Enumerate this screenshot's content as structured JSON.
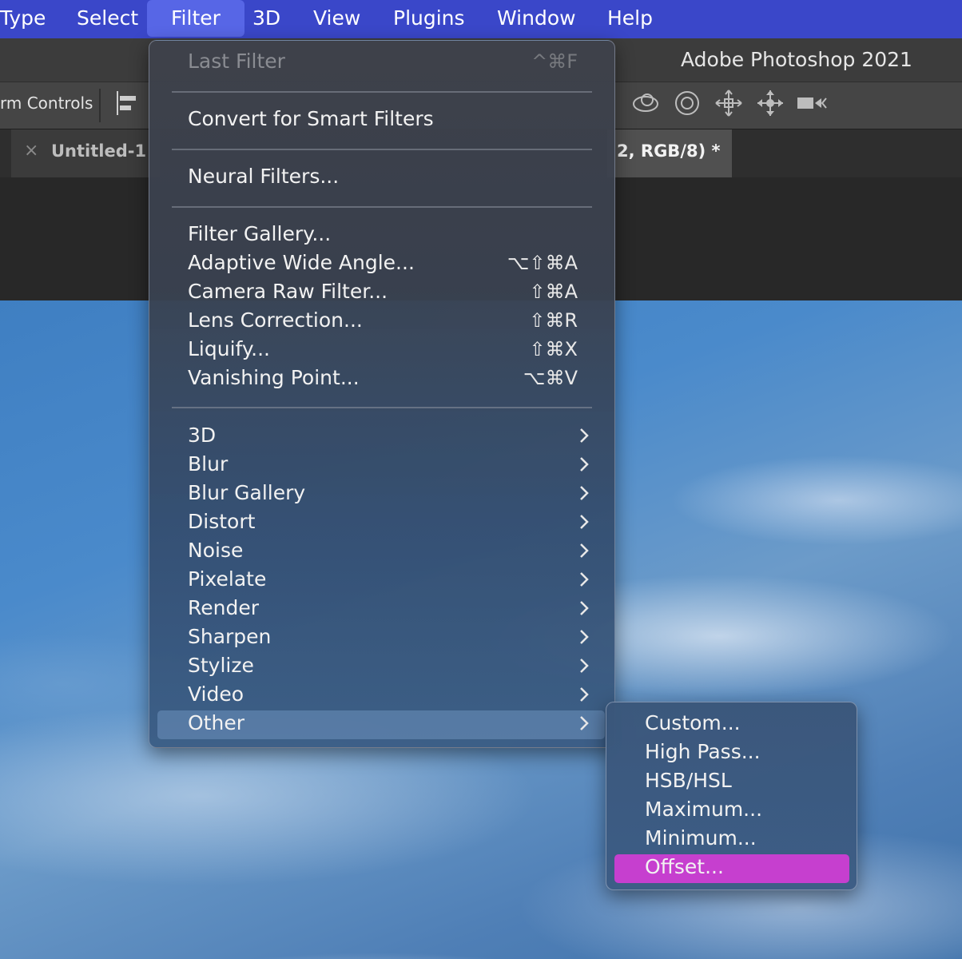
{
  "menubar": {
    "items": [
      "Type",
      "Select",
      "Filter",
      "3D",
      "View",
      "Plugins",
      "Window",
      "Help"
    ],
    "active": "Filter"
  },
  "app": {
    "title": "Adobe Photoshop 2021"
  },
  "options_bar": {
    "label": "rm Controls"
  },
  "tabs": [
    {
      "label": "Untitled-1",
      "close": "×"
    },
    {
      "label": "2, RGB/8) *"
    }
  ],
  "filter_menu": {
    "last_filter": {
      "label": "Last Filter",
      "shortcut": "^⌘F"
    },
    "convert_smart": "Convert for Smart Filters",
    "neural": "Neural Filters...",
    "items": [
      {
        "label": "Filter Gallery...",
        "shortcut": ""
      },
      {
        "label": "Adaptive Wide Angle...",
        "shortcut": "⌥⇧⌘A"
      },
      {
        "label": "Camera Raw Filter...",
        "shortcut": "⇧⌘A"
      },
      {
        "label": "Lens Correction...",
        "shortcut": "⇧⌘R"
      },
      {
        "label": "Liquify...",
        "shortcut": "⇧⌘X"
      },
      {
        "label": "Vanishing Point...",
        "shortcut": "⌥⌘V"
      }
    ],
    "submenus": [
      "3D",
      "Blur",
      "Blur Gallery",
      "Distort",
      "Noise",
      "Pixelate",
      "Render",
      "Sharpen",
      "Stylize",
      "Video",
      "Other"
    ],
    "highlighted": "Other"
  },
  "other_submenu": {
    "items": [
      "Custom...",
      "High Pass...",
      "HSB/HSL",
      "Maximum...",
      "Minimum...",
      "Offset..."
    ],
    "selected": "Offset...",
    "selected_color": "#c63fcf"
  }
}
